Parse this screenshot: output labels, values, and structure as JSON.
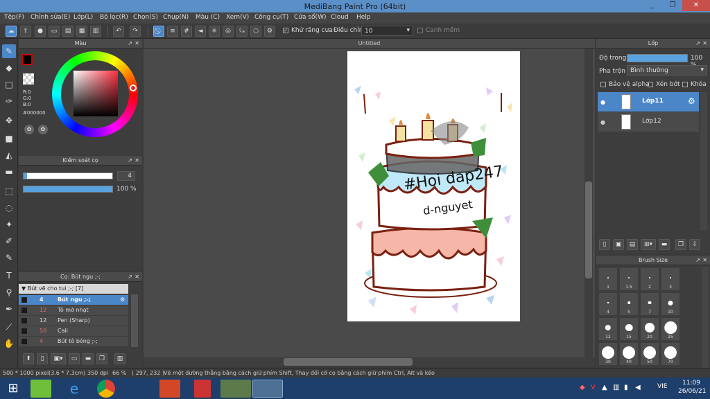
{
  "window": {
    "title": "MediBang Paint Pro (64bit)",
    "min": "_",
    "max": "❐",
    "close": "✕"
  },
  "menu": [
    "Tệp(F)",
    "Chỉnh sửa(E)",
    "Lớp(L)",
    "Bộ lọc(R)",
    "Chọn(S)",
    "Chụp(N)",
    "Màu (C)",
    "Xem(V)",
    "Công cụ(T)",
    "Cửa sổ(W)",
    "Cloud",
    "Help"
  ],
  "toolbar": {
    "antialias_label": "Khử răng cưa",
    "adjust_label": "Điều chỉnh",
    "adjust_value": "10",
    "edge_label": "Canh mềm"
  },
  "color_panel": {
    "title": "Màu",
    "r": "R:0",
    "g": "G:0",
    "b": "B:0",
    "hex": "#000000"
  },
  "brush_control": {
    "title": "Kiểm soát cọ",
    "size_value": "4",
    "opacity_value": "100 %",
    "size_fraction": 0.04,
    "opacity_fraction": 1.0
  },
  "brush_panel": {
    "title": "Cọ: Bút ngu ;-;",
    "group": "Bút vẽ cho tui ;-; [7]",
    "items": [
      {
        "size": "4",
        "name": "Bút ngu ;-;"
      },
      {
        "size": "12",
        "name": "Tô mờ nhạt"
      },
      {
        "size": "12",
        "name": "Pen (Sharp)"
      },
      {
        "size": "50",
        "name": "Cali"
      },
      {
        "size": "4",
        "name": "Bút tô bóng ;-;"
      }
    ]
  },
  "canvas": {
    "tab": "Untitled",
    "handwriting1": "#Hoi dap247",
    "handwriting2": "d-nguyet"
  },
  "layer_panel": {
    "title": "Lớp",
    "opacity_label": "Độ trong",
    "opacity_value": "100 %",
    "opacity_fraction": 1.0,
    "blend_label": "Pha trộn",
    "blend_value": "Bình thường",
    "protect_alpha": "Bảo vệ alpha",
    "clip": "Xén bớt",
    "lock": "Khóa",
    "layers": [
      {
        "name": "Lớp11"
      },
      {
        "name": "Lớp12"
      }
    ]
  },
  "brush_size_panel": {
    "title": "Brush Size",
    "sizes": [
      "1",
      "1.5",
      "2",
      "3",
      "4",
      "5",
      "7",
      "10",
      "12",
      "15",
      "20",
      "25",
      "30",
      "40",
      "50",
      "70"
    ],
    "dot_px_hint": true
  },
  "status": {
    "size": "500 * 1000 pixel",
    "cm": "(3.6 * 7.3cm)",
    "dpi": "350 dpi",
    "zoom": "66 %",
    "coords": "( 297, 232 )",
    "hint": "Vẽ một đường thẳng bằng cách giữ phím Shift, Thay đổi cỡ cọ bằng cách giữ phím Ctrl, Alt và kéo"
  },
  "taskbar": {
    "lang": "VIE",
    "time": "11:09",
    "date": "26/06/21"
  },
  "colors": {
    "accent": "#4b86c8",
    "titlebar": "#5b8fc7",
    "panel": "#3d3d3d"
  }
}
